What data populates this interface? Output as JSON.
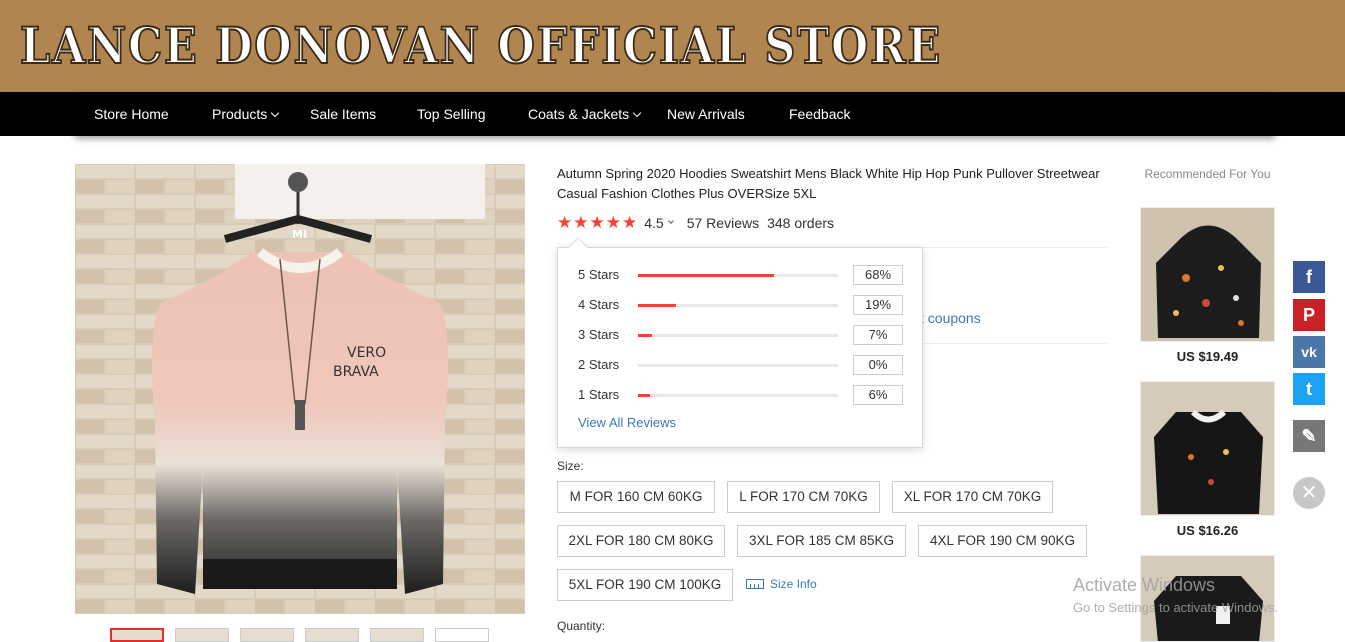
{
  "store": {
    "title": "LANCE DONOVAN OFFICIAL STORE"
  },
  "nav": {
    "items": [
      {
        "label": "Store Home",
        "dropdown": false
      },
      {
        "label": "Products",
        "dropdown": true
      },
      {
        "label": "Sale Items",
        "dropdown": false
      },
      {
        "label": "Top Selling",
        "dropdown": false
      },
      {
        "label": "Coats & Jackets",
        "dropdown": true
      },
      {
        "label": "New Arrivals",
        "dropdown": false
      },
      {
        "label": "Feedback",
        "dropdown": false
      }
    ]
  },
  "product": {
    "title": "Autumn Spring 2020 Hoodies Sweatshirt Mens Black White Hip Hop Punk Pullover Streetwear Casual Fashion Clothes Plus OVERSize 5XL",
    "rating": "4.5",
    "stars_filled": 5,
    "reviews": "57 Reviews",
    "orders": "348 orders",
    "coupons_link": "t coupons",
    "image_print_text": "VERO BRAVA",
    "hanger_logo": "MI"
  },
  "rating_popup": {
    "rows": [
      {
        "label": "5 Stars",
        "percent": "68%",
        "fraction": 0.68
      },
      {
        "label": "4 Stars",
        "percent": "19%",
        "fraction": 0.19
      },
      {
        "label": "3 Stars",
        "percent": "7%",
        "fraction": 0.07
      },
      {
        "label": "2 Stars",
        "percent": "0%",
        "fraction": 0.0
      },
      {
        "label": "1 Stars",
        "percent": "6%",
        "fraction": 0.06
      }
    ],
    "view_all": "View All Reviews"
  },
  "size": {
    "label": "Size:",
    "options": [
      "M FOR 160 CM 60KG",
      "L FOR 170 CM 70KG",
      "XL FOR 170 CM 70KG",
      "2XL FOR 180 CM 80KG",
      "3XL FOR 185 CM 85KG",
      "4XL FOR 190 CM 90KG",
      "5XL FOR 190 CM 100KG"
    ],
    "size_info": "Size Info"
  },
  "quantity": {
    "label": "Quantity:"
  },
  "recommended": {
    "title": "Recommended For You",
    "items": [
      {
        "price": "US $19.49"
      },
      {
        "price": "US $16.26"
      }
    ]
  },
  "share": {
    "buttons": [
      {
        "icon": "facebook-icon",
        "glyph": "f",
        "color": "#3b5998"
      },
      {
        "icon": "pinterest-icon",
        "glyph": "P",
        "color": "#cb2027"
      },
      {
        "icon": "vk-icon",
        "glyph": "vk",
        "color": "#4a76a8"
      },
      {
        "icon": "twitter-icon",
        "glyph": "t",
        "color": "#1da1f2"
      },
      {
        "icon": "edit-icon",
        "glyph": "✎",
        "color": "#777777"
      }
    ],
    "close_glyph": "✕"
  },
  "watermark": {
    "line1": "Activate Windows",
    "line2": "Go to Settings to activate Windows."
  },
  "colors": {
    "banner": "#b08550",
    "nav": "#000000",
    "accent": "#f44336",
    "link": "#3e77b8"
  }
}
